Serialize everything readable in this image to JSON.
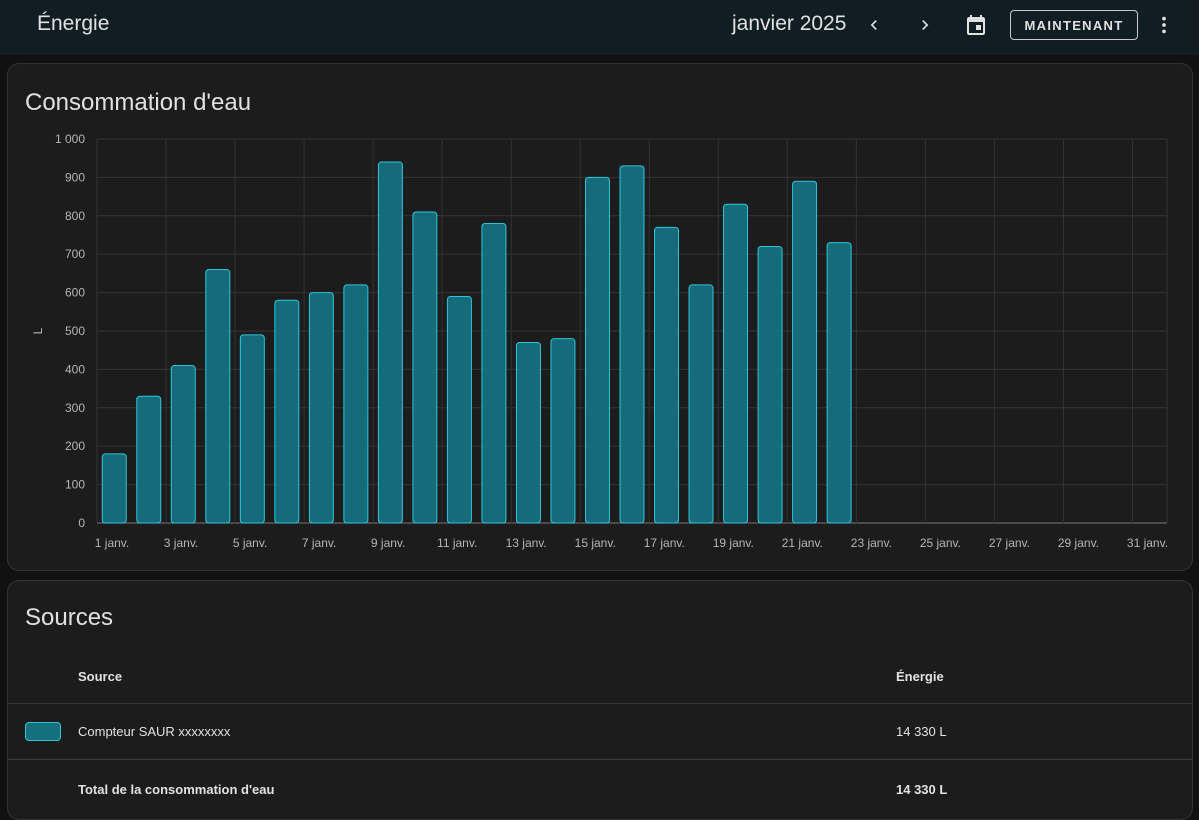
{
  "header": {
    "title": "Énergie",
    "period": "janvier 2025",
    "now_label": "MAINTENANT",
    "icons": [
      "chevron-left-icon",
      "chevron-right-icon",
      "calendar-icon",
      "more-vert-icon"
    ]
  },
  "chart_card": {
    "title": "Consommation d'eau"
  },
  "chart_data": {
    "type": "bar",
    "title": "Consommation d'eau",
    "xlabel": "",
    "ylabel": "L",
    "ylim": [
      0,
      1000
    ],
    "yticks": [
      0,
      100,
      200,
      300,
      400,
      500,
      600,
      700,
      800,
      900,
      1000
    ],
    "ytick_labels": [
      "0",
      "100",
      "200",
      "300",
      "400",
      "500",
      "600",
      "700",
      "800",
      "900",
      "1 000"
    ],
    "xtick_labels": [
      "1 janv.",
      "3 janv.",
      "5 janv.",
      "7 janv.",
      "9 janv.",
      "11 janv.",
      "13 janv.",
      "15 janv.",
      "17 janv.",
      "19 janv.",
      "21 janv.",
      "23 janv.",
      "25 janv.",
      "27 janv.",
      "29 janv.",
      "31 janv."
    ],
    "days": 31,
    "grid": true,
    "series": [
      {
        "values": [
          180,
          330,
          410,
          660,
          490,
          580,
          600,
          620,
          940,
          810,
          590,
          780,
          470,
          480,
          900,
          930,
          770,
          620,
          830,
          720,
          890,
          730
        ],
        "color": "#15707e",
        "border_color": "#2fc5d8"
      }
    ]
  },
  "sources_card": {
    "title": "Sources",
    "col_source": "Source",
    "col_energy": "Énergie",
    "rows": [
      {
        "source": "Compteur SAUR xxxxxxxx",
        "energy": "14 330 L"
      }
    ],
    "total_label": "Total de la consommation d'eau",
    "total_value": "14 330 L"
  },
  "colors": {
    "header_bg": "#101e24",
    "card_bg": "#1c1c1c",
    "bar_fill": "#15707e",
    "bar_border": "#2fc5d8"
  }
}
